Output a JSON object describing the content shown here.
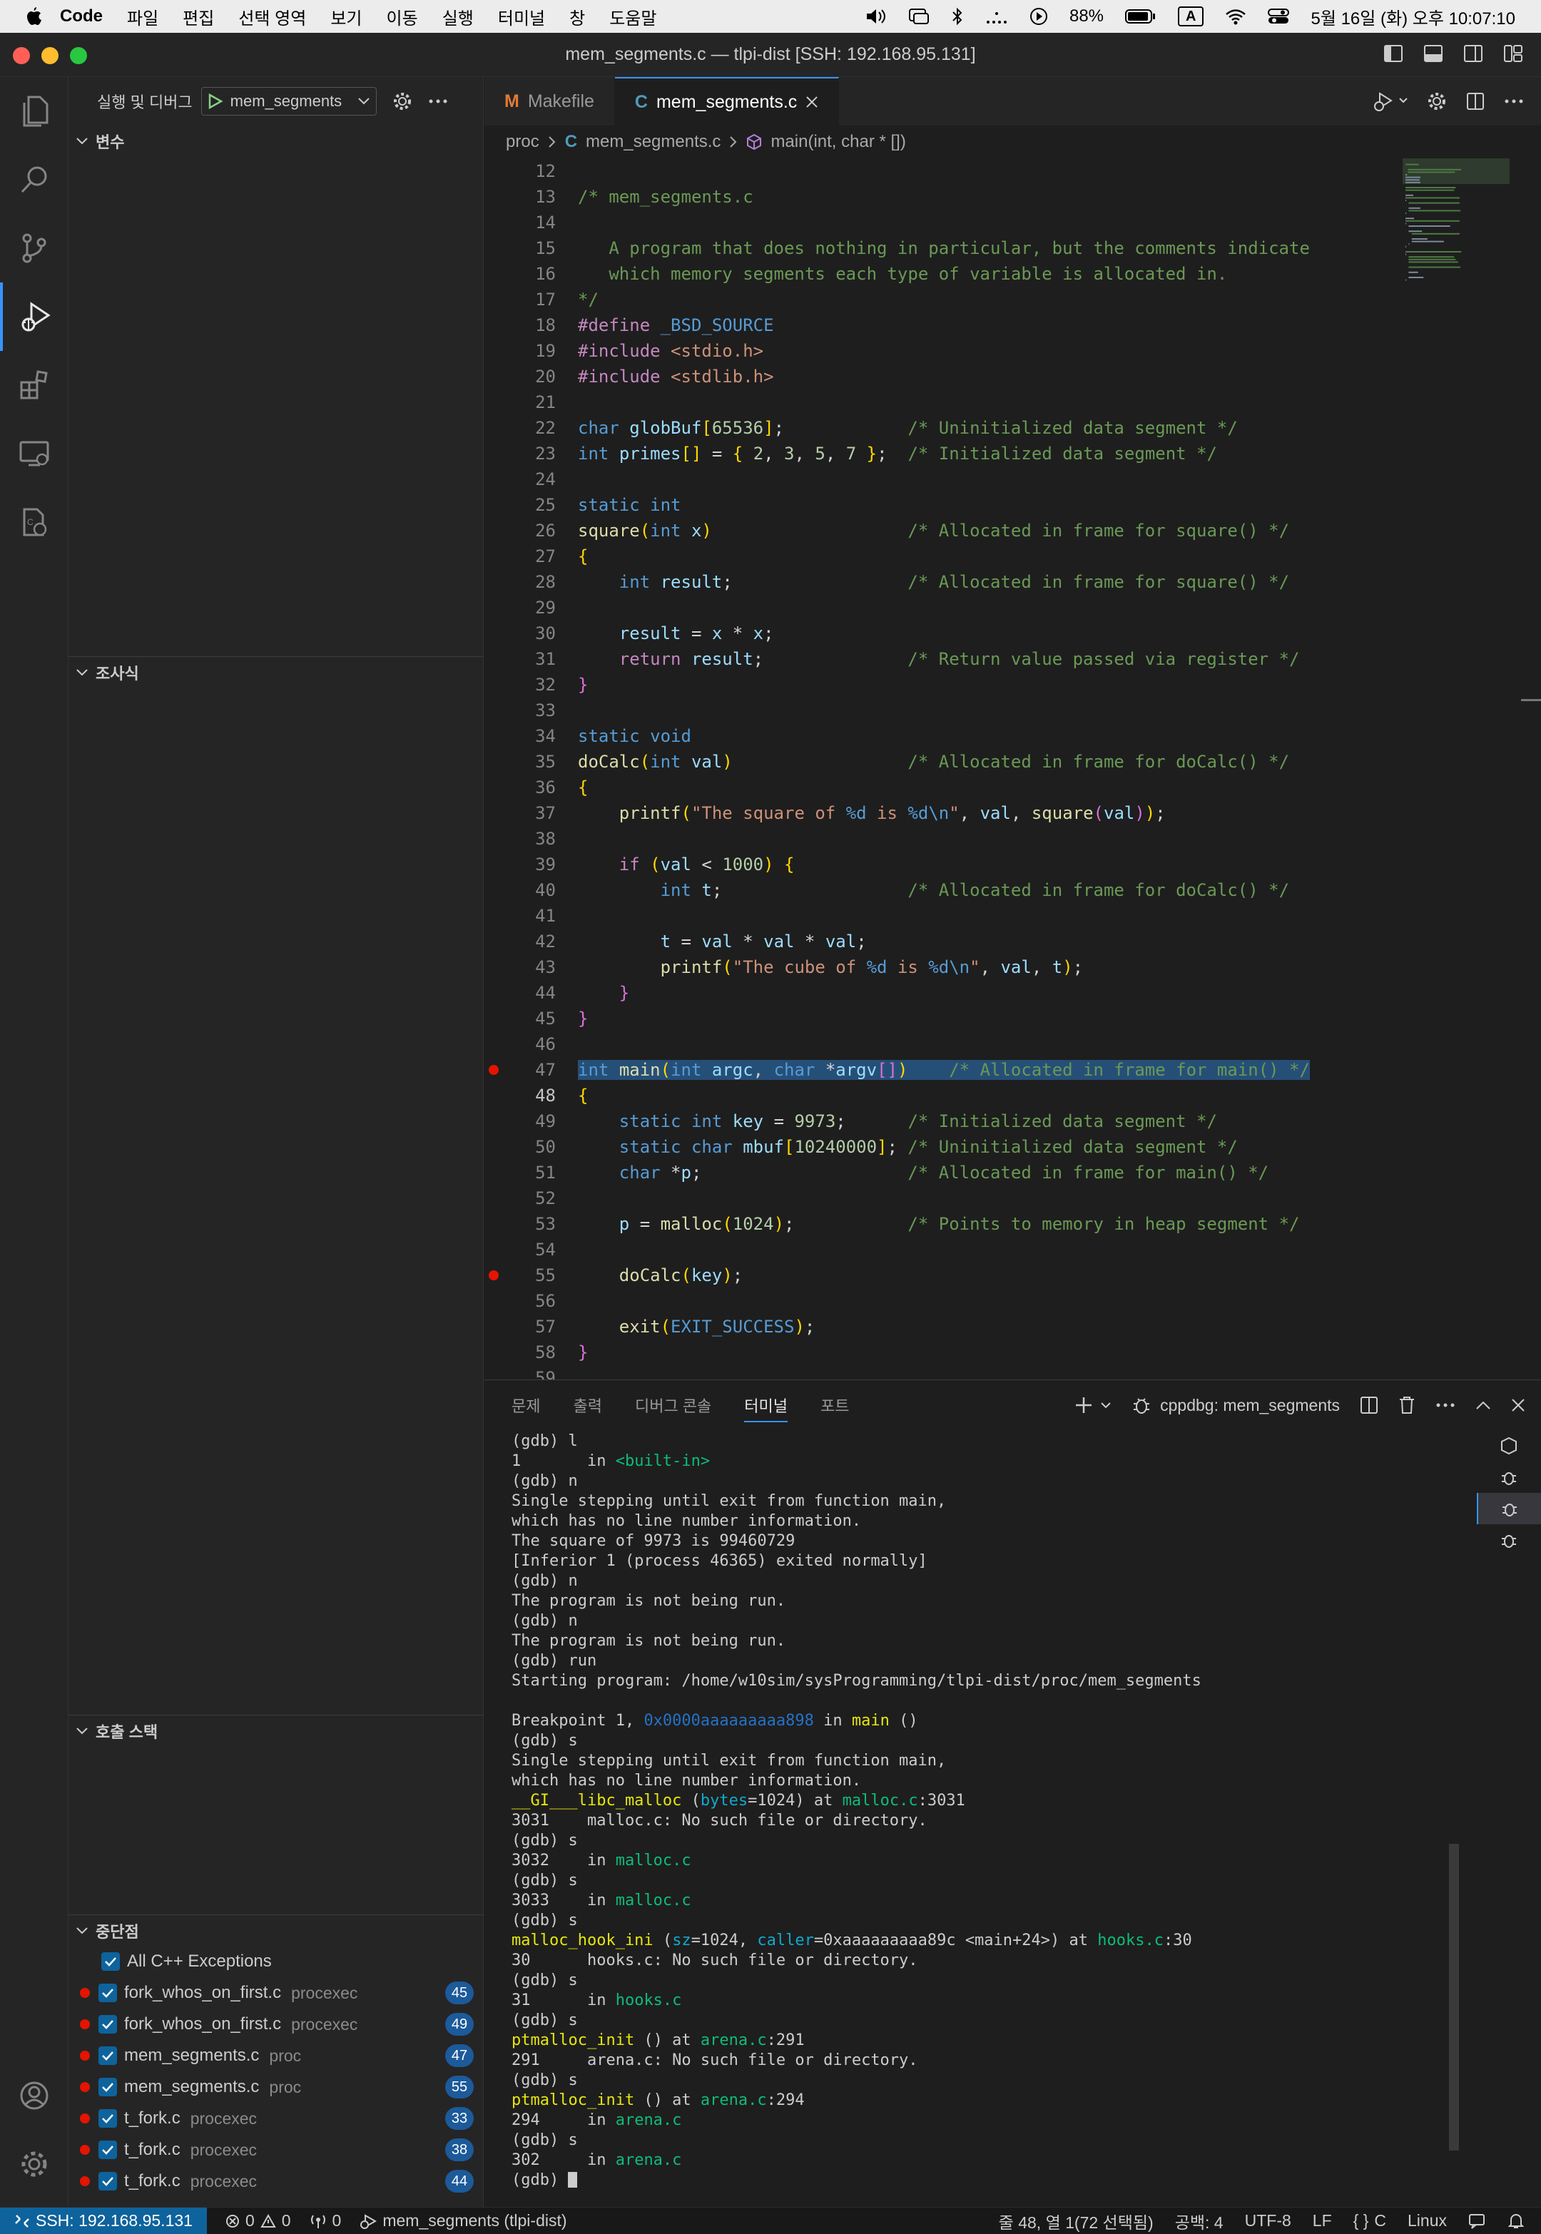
{
  "menubar": {
    "app": "Code",
    "items": [
      "파일",
      "편집",
      "선택 영역",
      "보기",
      "이동",
      "실행",
      "터미널",
      "창",
      "도움말"
    ],
    "battery": "88%",
    "input_mode": "A",
    "clock": "5월 16일 (화) 오후 10:07:10"
  },
  "window": {
    "title": "mem_segments.c — tlpi-dist [SSH: 192.168.95.131]"
  },
  "sidebar": {
    "title": "실행 및 디버그",
    "config": "mem_segments",
    "sections": {
      "variables": "변수",
      "watch": "조사식",
      "callstack": "호출 스택",
      "breakpoints": "중단점"
    },
    "all_exceptions": "All C++ Exceptions",
    "breakpoints": [
      {
        "file": "fork_whos_on_first.c",
        "path": "procexec",
        "line": "45"
      },
      {
        "file": "fork_whos_on_first.c",
        "path": "procexec",
        "line": "49"
      },
      {
        "file": "mem_segments.c",
        "path": "proc",
        "line": "47"
      },
      {
        "file": "mem_segments.c",
        "path": "proc",
        "line": "55"
      },
      {
        "file": "t_fork.c",
        "path": "procexec",
        "line": "33"
      },
      {
        "file": "t_fork.c",
        "path": "procexec",
        "line": "38"
      },
      {
        "file": "t_fork.c",
        "path": "procexec",
        "line": "44"
      }
    ]
  },
  "editor": {
    "tabs": [
      {
        "label": "Makefile",
        "icon": "M"
      },
      {
        "label": "mem_segments.c",
        "icon": "C"
      }
    ],
    "breadcrumb": [
      "proc",
      "mem_segments.c",
      "main(int, char * [])"
    ],
    "first_line": 12,
    "lines": [
      "",
      "/* mem_segments.c",
      "",
      "   A program that does nothing in particular, but the comments indicate",
      "   which memory segments each type of variable is allocated in.",
      "*/",
      "#define _BSD_SOURCE",
      "#include <stdio.h>",
      "#include <stdlib.h>",
      "",
      "char globBuf[65536];            /* Uninitialized data segment */",
      "int primes[] = { 2, 3, 5, 7 };  /* Initialized data segment */",
      "",
      "static int",
      "square(int x)                   /* Allocated in frame for square() */",
      "{",
      "    int result;                 /* Allocated in frame for square() */",
      "",
      "    result = x * x;",
      "    return result;              /* Return value passed via register */",
      "}",
      "",
      "static void",
      "doCalc(int val)                 /* Allocated in frame for doCalc() */",
      "{",
      "    printf(\"The square of %d is %d\\n\", val, square(val));",
      "",
      "    if (val < 1000) {",
      "        int t;                  /* Allocated in frame for doCalc() */",
      "",
      "        t = val * val * val;",
      "        printf(\"The cube of %d is %d\\n\", val, t);",
      "    }",
      "}",
      "",
      "int main(int argc, char *argv[])    /* Allocated in frame for main() */",
      "{",
      "    static int key = 9973;      /* Initialized data segment */",
      "    static char mbuf[10240000]; /* Uninitialized data segment */",
      "    char *p;                    /* Allocated in frame for main() */",
      "",
      "    p = malloc(1024);           /* Points to memory in heap segment */",
      "",
      "    doCalc(key);",
      "",
      "    exit(EXIT_SUCCESS);",
      "}",
      ""
    ],
    "breakpoint_lines": [
      47,
      55
    ],
    "current_line": 48,
    "selected_line": 47
  },
  "panel": {
    "tabs": [
      "문제",
      "출력",
      "디버그 콘솔",
      "터미널",
      "포트"
    ],
    "active_tab": "터미널",
    "terminal_name": "cppdbg: mem_segments",
    "terminal_lines": [
      "(gdb) l",
      "1       in <built-in>",
      "(gdb) n",
      "Single stepping until exit from function main,",
      "which has no line number information.",
      "The square of 9973 is 99460729",
      "[Inferior 1 (process 46365) exited normally]",
      "(gdb) n",
      "The program is not being run.",
      "(gdb) n",
      "The program is not being run.",
      "(gdb) run",
      "Starting program: /home/w10sim/sysProgramming/tlpi-dist/proc/mem_segments",
      "",
      "Breakpoint 1, 0x0000aaaaaaaaa898 in main ()",
      "(gdb) s",
      "Single stepping until exit from function main,",
      "which has no line number information.",
      "__GI___libc_malloc (bytes=1024) at malloc.c:3031",
      "3031    malloc.c: No such file or directory.",
      "(gdb) s",
      "3032    in malloc.c",
      "(gdb) s",
      "3033    in malloc.c",
      "(gdb) s",
      "malloc_hook_ini (sz=1024, caller=0xaaaaaaaaa89c <main+24>) at hooks.c:30",
      "30      hooks.c: No such file or directory.",
      "(gdb) s",
      "31      in hooks.c",
      "(gdb) s",
      "ptmalloc_init () at arena.c:291",
      "291     arena.c: No such file or directory.",
      "(gdb) s",
      "ptmalloc_init () at arena.c:294",
      "294     in arena.c",
      "(gdb) s",
      "302     in arena.c",
      "(gdb) "
    ]
  },
  "statusbar": {
    "remote": "SSH: 192.168.95.131",
    "errors": "0",
    "warnings": "0",
    "ports": "0",
    "launch": "mem_segments (tlpi-dist)",
    "position": "줄 48, 열 1(72 선택됨)",
    "spaces": "공백: 4",
    "encoding": "UTF-8",
    "eol": "LF",
    "language": "C",
    "os": "Linux"
  },
  "colors": {
    "accent": "#3794ff",
    "breakpoint": "#e51400",
    "badge": "#1c5a9a"
  }
}
